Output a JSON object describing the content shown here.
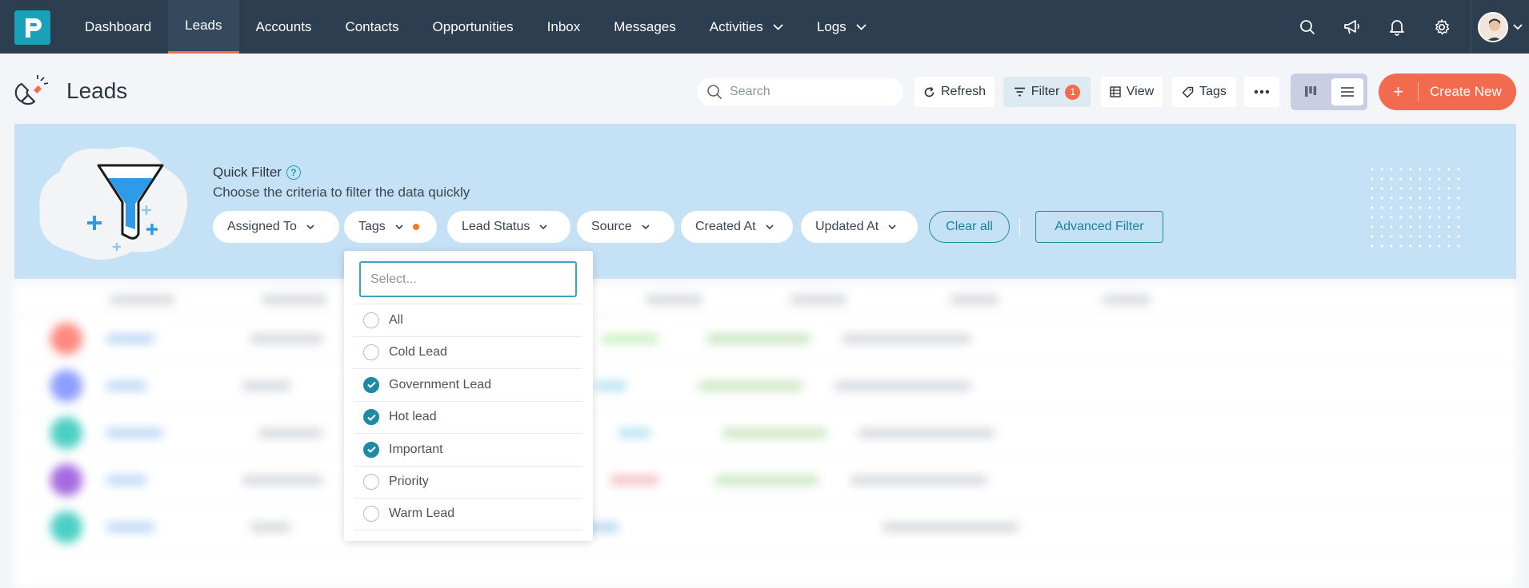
{
  "nav": {
    "items": [
      {
        "label": "Dashboard",
        "active": false,
        "dropdown": false
      },
      {
        "label": "Leads",
        "active": true,
        "dropdown": false
      },
      {
        "label": "Accounts",
        "active": false,
        "dropdown": false
      },
      {
        "label": "Contacts",
        "active": false,
        "dropdown": false
      },
      {
        "label": "Opportunities",
        "active": false,
        "dropdown": false
      },
      {
        "label": "Inbox",
        "active": false,
        "dropdown": false
      },
      {
        "label": "Messages",
        "active": false,
        "dropdown": false
      },
      {
        "label": "Activities",
        "active": false,
        "dropdown": true
      },
      {
        "label": "Logs",
        "active": false,
        "dropdown": true
      }
    ],
    "icons": [
      "search-icon",
      "megaphone-icon",
      "bell-icon",
      "gear-icon"
    ],
    "active_color": "#f26b4e",
    "bg_color": "#2c3e50"
  },
  "header": {
    "title": "Leads",
    "search_placeholder": "Search",
    "refresh_label": "Refresh",
    "filter_label": "Filter",
    "filter_count": "1",
    "view_label": "View",
    "tags_label": "Tags",
    "create_label": "Create New",
    "create_plus": "+"
  },
  "quick_filter": {
    "title": "Quick Filter",
    "help": "?",
    "subtitle": "Choose the criteria to filter the data quickly",
    "pills": [
      {
        "label": "Assigned To"
      },
      {
        "label": "Tags"
      },
      {
        "label": "Lead Status"
      },
      {
        "label": "Source"
      },
      {
        "label": "Created At"
      },
      {
        "label": "Updated At"
      }
    ],
    "clear_all": "Clear all",
    "advanced": "Advanced Filter"
  },
  "tags_dropdown": {
    "placeholder": "Select...",
    "options": [
      {
        "label": "All",
        "checked": false
      },
      {
        "label": "Cold Lead",
        "checked": false
      },
      {
        "label": "Government Lead",
        "checked": true
      },
      {
        "label": "Hot lead",
        "checked": true
      },
      {
        "label": "Important",
        "checked": true
      },
      {
        "label": "Priority",
        "checked": false
      },
      {
        "label": "Warm Lead",
        "checked": false
      }
    ]
  }
}
